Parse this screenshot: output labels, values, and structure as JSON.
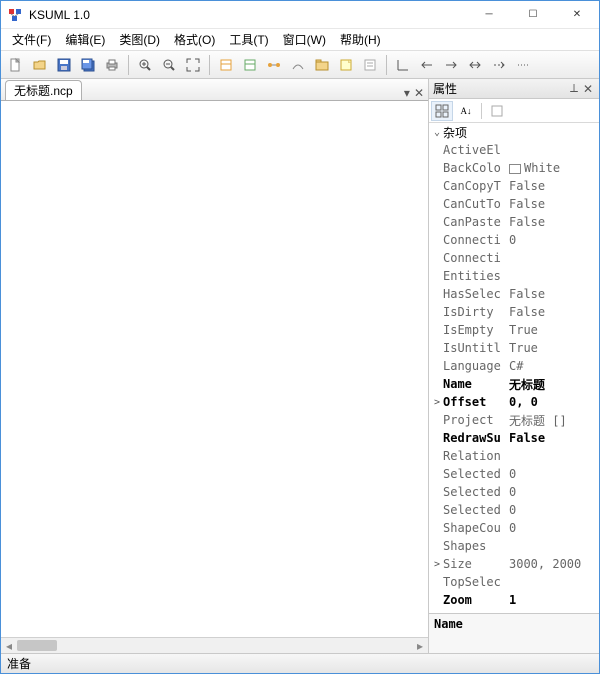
{
  "window": {
    "title": "KSUML 1.0"
  },
  "menu": {
    "items": [
      "文件(F)",
      "编辑(E)",
      "类图(D)",
      "格式(O)",
      "工具(T)",
      "窗口(W)",
      "帮助(H)"
    ]
  },
  "toolbar": {
    "groups": [
      [
        "new-file-icon",
        "open-icon",
        "save-icon",
        "save-all-icon",
        "print-icon"
      ],
      [
        "zoom-in-icon",
        "zoom-out-icon",
        "fit-icon"
      ],
      [
        "class-icon",
        "interface-icon",
        "relation-icon",
        "assoc-icon",
        "package-icon",
        "note-icon",
        "comment-icon"
      ],
      [
        "line-icon",
        "arrow-left-icon",
        "arrow-right-icon",
        "arrow-bi-icon",
        "dash-arrow-icon",
        "dotted-icon"
      ]
    ]
  },
  "document": {
    "tab_label": "无标题.ncp",
    "dropdown": "▾",
    "close": "✕"
  },
  "properties": {
    "panel_title": "属性",
    "pin": "⟂",
    "close": "✕",
    "category": "杂项",
    "rows": [
      {
        "exp": "",
        "key": "ActiveEl",
        "val": "",
        "bold": false
      },
      {
        "exp": "",
        "key": "BackColo",
        "val": "White",
        "bold": false,
        "color": true
      },
      {
        "exp": "",
        "key": "CanCopyT",
        "val": "False",
        "bold": false
      },
      {
        "exp": "",
        "key": "CanCutTo",
        "val": "False",
        "bold": false
      },
      {
        "exp": "",
        "key": "CanPaste",
        "val": "False",
        "bold": false
      },
      {
        "exp": "",
        "key": "Connecti",
        "val": "0",
        "bold": false
      },
      {
        "exp": "",
        "key": "Connecti",
        "val": "",
        "bold": false
      },
      {
        "exp": "",
        "key": "Entities",
        "val": "",
        "bold": false
      },
      {
        "exp": "",
        "key": "HasSelec",
        "val": "False",
        "bold": false
      },
      {
        "exp": "",
        "key": "IsDirty",
        "val": "False",
        "bold": false
      },
      {
        "exp": "",
        "key": "IsEmpty",
        "val": "True",
        "bold": false
      },
      {
        "exp": "",
        "key": "IsUntitl",
        "val": "True",
        "bold": false
      },
      {
        "exp": "",
        "key": "Language",
        "val": "C#",
        "bold": false
      },
      {
        "exp": "",
        "key": "Name",
        "val": "无标题",
        "bold": true
      },
      {
        "exp": ">",
        "key": "Offset",
        "val": "0, 0",
        "bold": true
      },
      {
        "exp": "",
        "key": "Project",
        "val": "无标题 []",
        "bold": false
      },
      {
        "exp": "",
        "key": "RedrawSu",
        "val": "False",
        "bold": true
      },
      {
        "exp": "",
        "key": "Relation",
        "val": "",
        "bold": false
      },
      {
        "exp": "",
        "key": "Selected",
        "val": "0",
        "bold": false
      },
      {
        "exp": "",
        "key": "Selected",
        "val": "0",
        "bold": false
      },
      {
        "exp": "",
        "key": "Selected",
        "val": "0",
        "bold": false
      },
      {
        "exp": "",
        "key": "ShapeCou",
        "val": "0",
        "bold": false
      },
      {
        "exp": "",
        "key": "Shapes",
        "val": "",
        "bold": false
      },
      {
        "exp": ">",
        "key": "Size",
        "val": "3000, 2000",
        "bold": false
      },
      {
        "exp": "",
        "key": "TopSelec",
        "val": "",
        "bold": false
      },
      {
        "exp": "",
        "key": "Zoom",
        "val": "1",
        "bold": true
      }
    ],
    "footer_title": "Name"
  },
  "status": {
    "text": "准备"
  }
}
